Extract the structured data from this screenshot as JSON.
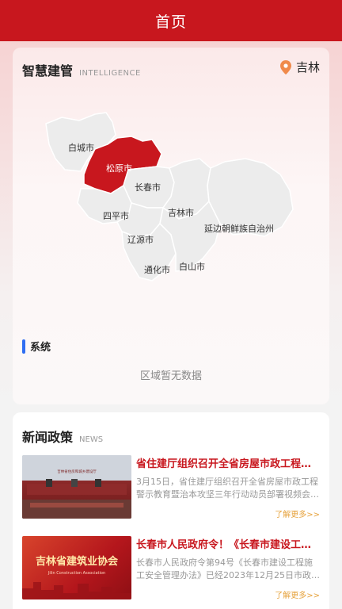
{
  "header": {
    "title": "首页"
  },
  "map_card": {
    "title": "智慧建管",
    "title_en": "INTELLIGENCE",
    "location": "吉林",
    "colors": {
      "highlight": "#c8171e",
      "region": "#ececec",
      "border": "#ffffff"
    },
    "regions": [
      {
        "name": "白城市",
        "highlighted": false
      },
      {
        "name": "松原市",
        "highlighted": true
      },
      {
        "name": "长春市",
        "highlighted": false
      },
      {
        "name": "四平市",
        "highlighted": false
      },
      {
        "name": "吉林市",
        "highlighted": false
      },
      {
        "name": "辽源市",
        "highlighted": false
      },
      {
        "name": "延边朝鲜族自治州",
        "highlighted": false
      },
      {
        "name": "通化市",
        "highlighted": false
      },
      {
        "name": "白山市",
        "highlighted": false
      }
    ],
    "section_label": "系统",
    "empty_text": "区域暂无数据"
  },
  "news": {
    "title": "新闻政策",
    "title_en": "NEWS",
    "items": [
      {
        "title": "省住建厅组织召开全省房屋市政工程…",
        "desc": "3月15日，省住建厅组织召开全省房屋市政工程警示教育暨治本攻坚三年行动动员部署视频会…",
        "more": "了解更多>>",
        "thumb_caption": "吉林省住房和城乡建设厅"
      },
      {
        "title": "长春市人民政府令！《长春市建设工程…",
        "desc": "长春市人民政府令第94号《长春市建设工程施工安全管理办法》已经2023年12月25日市政府第…",
        "more": "了解更多>>",
        "thumb_title": "吉林省建筑业协会",
        "thumb_sub": "Jilin Construction Association"
      }
    ]
  }
}
